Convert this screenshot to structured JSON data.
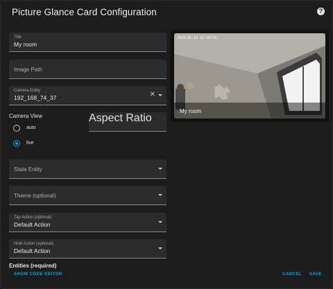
{
  "dialog": {
    "title": "Picture Glance Card Configuration",
    "help_icon": "help-circle-icon"
  },
  "form": {
    "title_field": {
      "label": "Title",
      "value": "My room"
    },
    "image_path": {
      "placeholder": "Image Path"
    },
    "camera_entity": {
      "label": "Camera Entity",
      "value": "192_168_74_37"
    },
    "camera_view": {
      "label": "Camera View",
      "options": [
        "auto",
        "live"
      ],
      "selected": "live"
    },
    "aspect_ratio": {
      "placeholder": "Aspect Ratio"
    },
    "state_entity": {
      "placeholder": "State Entity"
    },
    "theme": {
      "placeholder": "Theme (optional)"
    },
    "tap_action": {
      "label": "Tap Action (optional)",
      "value": "Default Action"
    },
    "hold_action": {
      "label": "Hold Action (optional)",
      "value": "Default Action"
    },
    "entities_label": "Entities (required)"
  },
  "preview": {
    "timestamp": "2023-01-12 12:10:53",
    "card_title": "My room"
  },
  "footer": {
    "show_code_editor": "SHOW CODE EDITOR",
    "cancel": "CANCEL",
    "save": "SAVE"
  },
  "colors": {
    "accent": "#03a9f4",
    "background": "#1c1c1c",
    "field_bg": "#2b2b2b"
  }
}
